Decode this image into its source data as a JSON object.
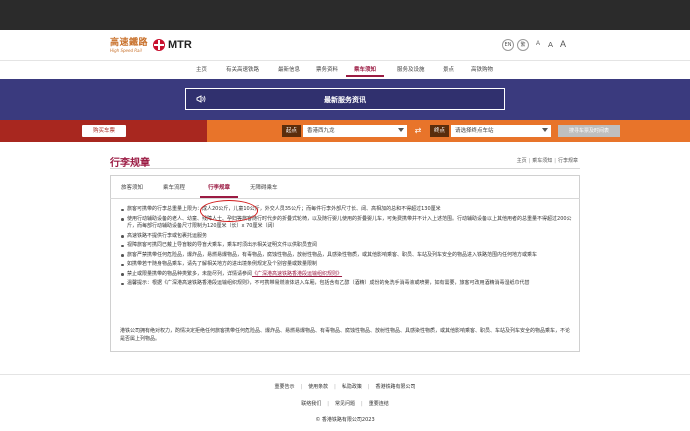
{
  "header": {
    "logo_hsr_cn": "高速鐵路",
    "logo_hsr_en": "High Speed Rail",
    "logo_mtr": "MTR",
    "lang_en": "EN",
    "lang_tc": "繁",
    "font_sizes": [
      "A",
      "A",
      "A"
    ]
  },
  "nav": {
    "items": [
      "主页",
      "有关高速铁路",
      "最新信息",
      "票务资料",
      "乘车须知",
      "服务及设施",
      "景点",
      "高铁购物"
    ],
    "active": "乘车须知"
  },
  "banner": {
    "title": "最新服务资讯"
  },
  "tripbar": {
    "buy_label": "购买车票",
    "from_label": "起点",
    "from_value": "香港西九龙",
    "to_label": "终点",
    "to_value": "请选择终点车站",
    "search_label": "搜寻车票及时间表"
  },
  "page": {
    "title": "行李规章",
    "breadcrumb": [
      "主页",
      "乘车须知",
      "行李规章"
    ]
  },
  "tabs": {
    "items": [
      "旅客须知",
      "乘车流程",
      "行李规章",
      "无障碍乘车"
    ],
    "active": "行李规章"
  },
  "rules": [
    "旅客可携带的行李总重量上限为：成人20公斤，儿童10公斤，外交人员35公斤；而每件行李外部尺寸长、阔、高相加的总和不得超过130厘米",
    "使用行动辅助设备的老人、幼童、残障人士、孕妇等旅客随行时代步的折叠式轮椅，以及随行婴儿使用的折叠婴儿车，可免费携带并不计入上述范围。行动辅助设备以上其他用者的总重量不得超过200公斤，而每部行动辅助设备尺寸限制为120厘米（长）x 70厘米（阔）",
    "高速铁路不提供行李或包裹托运服务",
    "视障旅客可携同已戴上导盲鞍的导盲犬乘车，乘车时须出示相关证明文件以供职员查阅",
    "旅客严禁携带任何危险品，爆炸品，易燃易爆物品，有毒物品，腐蚀性物品，放射性物品，具感染性物质，或其他影响乘客、职员、车站及列车安全的物品进入铁路范围内任何地方或乘车",
    "如携带若干随身物品乘车，请先了解相关地方的进出境条例规定及个别容量或数量限制",
    "禁止或限量携带的物品种类繁多，未能尽列，详情请参阅",
    "温馨提示：根据《广深港高速铁路香港段运输组织规则》，不可携带易燃液体进入车厢，包括含有乙醇（酒精）成份的免洗手消毒液或喷雾，如有需要，旅客可改用酒精消毒湿纸巾代替"
  ],
  "rules_link": "《广深港高速铁路香港段运输组织规则》",
  "rules_note": "港铁公司拥有绝对权力，酌情决定拒绝任何旅客携带任何危险品、爆炸品、易燃易爆物品、有毒物品、腐蚀性物品、放射性物品、具感染性物质，或其他影响乘客、职员、车站及列车安全的物品乘车，不论是否属上列物品。",
  "footer": {
    "row1": [
      "重要告示",
      "使用条款",
      "私隐政策",
      "香港铁路有限公司"
    ],
    "row2": [
      "联络我们",
      "常见问题",
      "重要连结"
    ],
    "copyright": "© 香港铁路有限公司2023"
  },
  "colors": {
    "brand": "#9b1b43",
    "banner": "#3a3a7e",
    "trip_left": "#a8271f",
    "trip_right": "#e8742a",
    "highlight": "#d11a1a"
  }
}
